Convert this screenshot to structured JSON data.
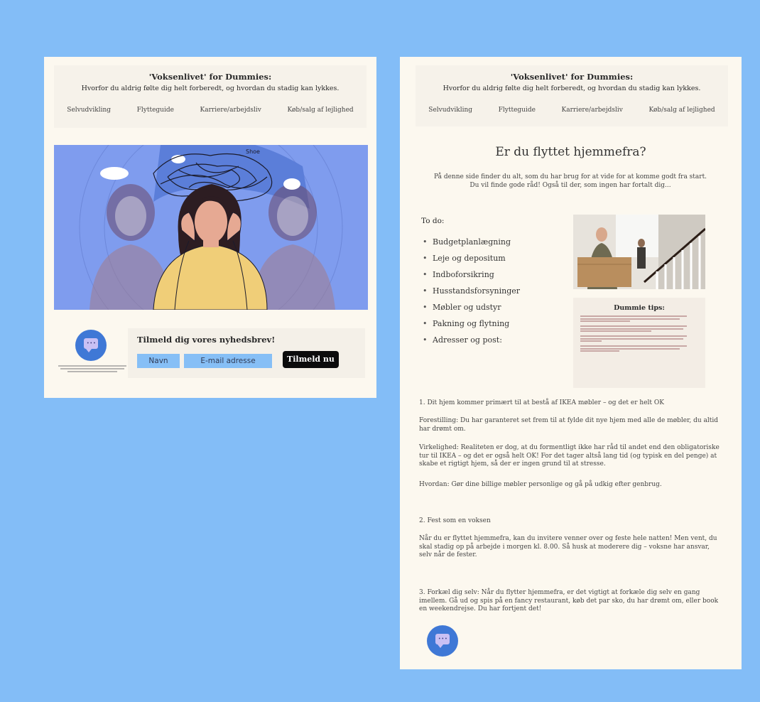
{
  "site": {
    "title": "'Voksenlivet' for Dummies:",
    "tagline": "Hvorfor du aldrig følte dig helt forberedt, og hvordan du stadig kan lykkes.",
    "nav": [
      "Selvudvikling",
      "Flytteguide",
      "Karriere/arbejdsliv",
      "Køb/salg af lejlighed"
    ]
  },
  "newsletter": {
    "title": "Tilmeld dig vores nyhedsbrev!",
    "name_placeholder": "Navn",
    "email_placeholder": "E-mail adresse",
    "button_label": "Tilmeld nu"
  },
  "hero": {
    "doodle_text": "Shoe"
  },
  "right": {
    "heading": "Er du flyttet hjemmefra?",
    "intro_line1": "På denne side finder du alt, som du har brug for at vide for at komme godt fra start.",
    "intro_line2": "Du vil finde gode råd! Også til der, som ingen har fortalt dig...",
    "todo_label": "To do:",
    "todo_items": [
      "Budgetplanlægning",
      "Leje og depositum",
      "Indboforsikring",
      "Husstandsforsyninger",
      "Møbler og udstyr",
      "Pakning og flytning",
      "Adresser og post:"
    ],
    "tips_title": "Dummie tips:",
    "section1_title": "1. Dit hjem kommer primært til at bestå af IKEA møbler – og det er helt OK",
    "section1_p1": "Forestilling: Du har garanteret set frem til at fylde dit nye hjem med alle de møbler, du altid har drømt om.",
    "section1_p2": "Virkelighed: Realiteten er dog, at du formentligt ikke har råd til andet end den obligatoriske tur til IKEA – og det er også helt OK! For det tager altså lang tid (og typisk en del penge) at skabe et rigtigt hjem, så der er ingen grund til at stresse.",
    "section1_p3": "Hvordan: Gør dine billige møbler personlige og gå på udkig efter genbrug.",
    "section2_title": "2. Fest som en voksen",
    "section2_p1": "Når du er flyttet hjemmefra, kan du invitere venner over og feste hele natten! Men vent, du skal stadig op på arbejde i morgen kl. 8.00. Så husk at moderere dig – voksne har ansvar, selv når de fester.",
    "section3_p1": "3. Forkæl dig selv: Når du flytter hjemmefra, er det vigtigt at forkæle dig selv en gang imellem. Gå ud og spis på en fancy restaurant, køb det par sko, du har drømt om, eller book en weekendrejse. Du har fortjent det!"
  },
  "colors": {
    "background": "#83bdf7",
    "page": "#fcf8ef",
    "input": "#86bff6",
    "chat_icon": "#3f78d6",
    "hero": "#7f9cee"
  }
}
